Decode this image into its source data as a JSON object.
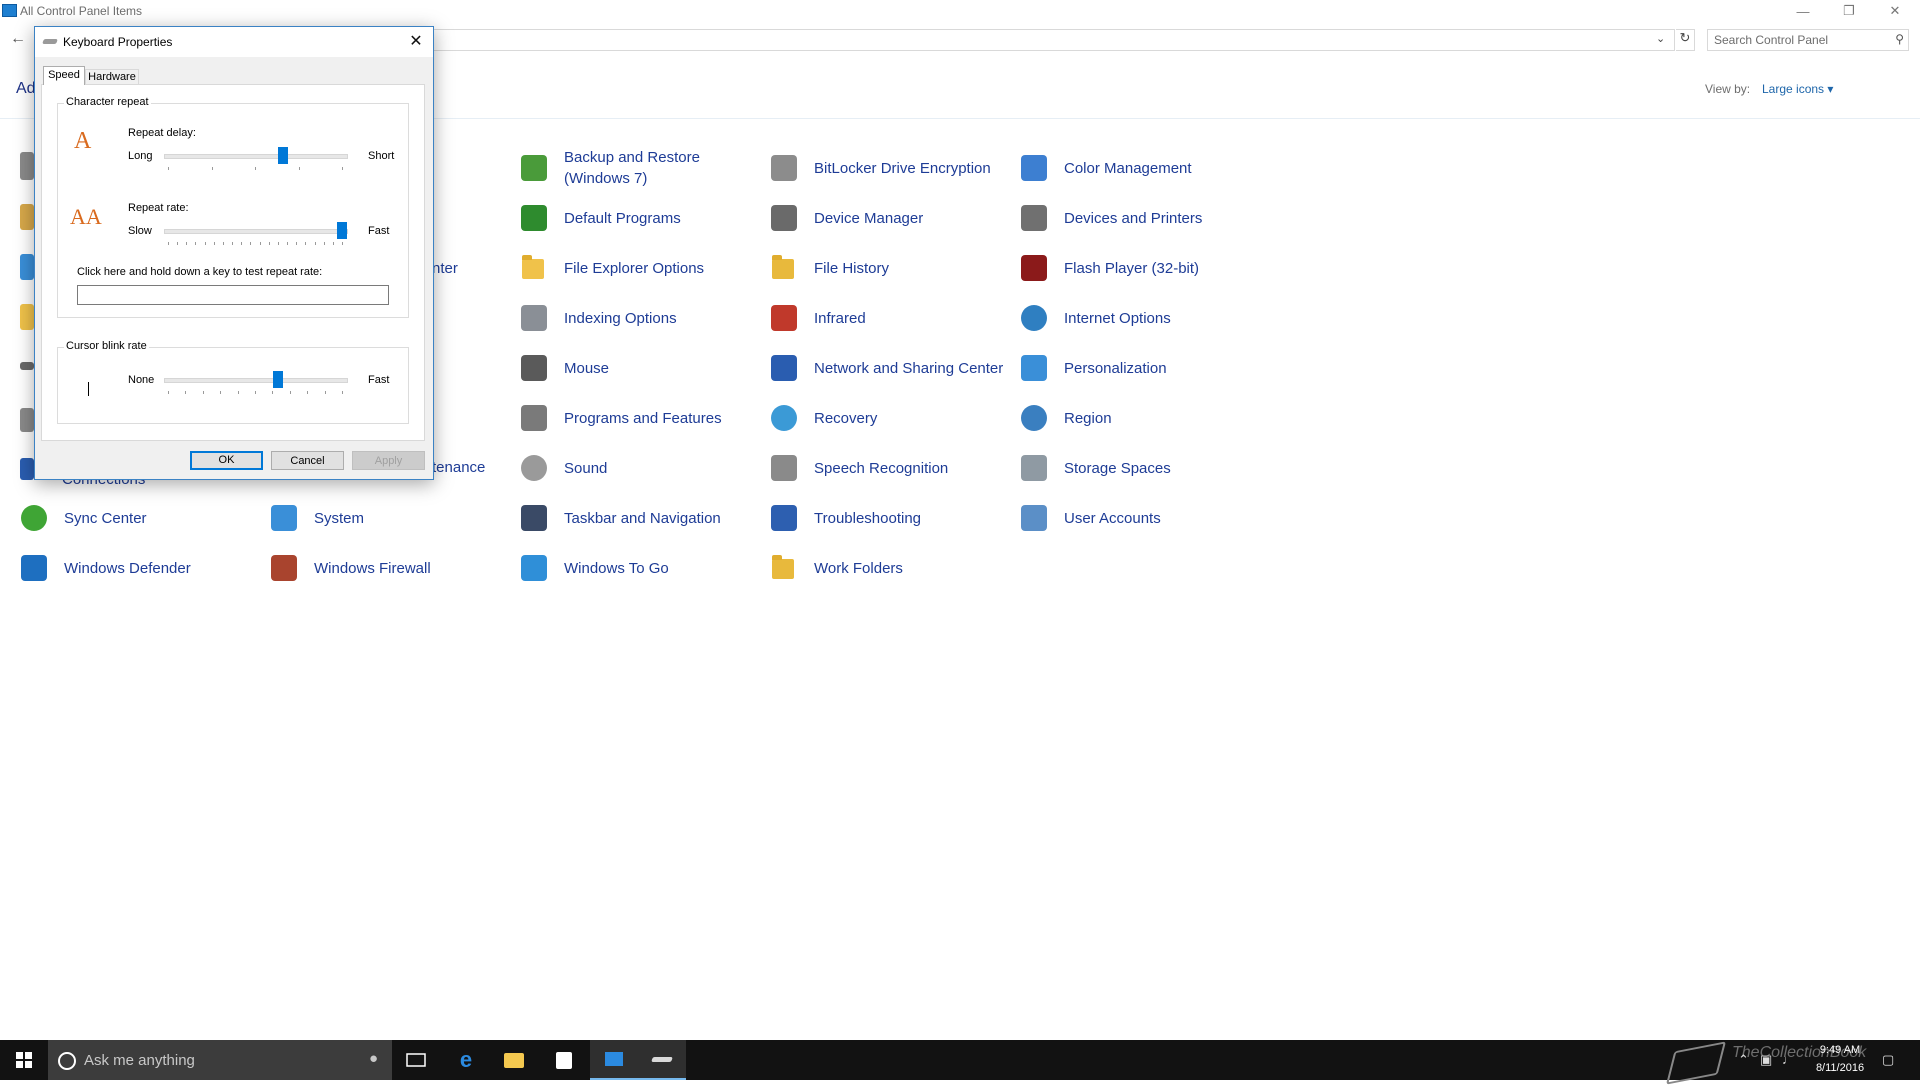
{
  "window": {
    "title": "All Control Panel Items"
  },
  "address": {
    "search_placeholder": "Search Control Panel"
  },
  "header": {
    "heading": "Ad",
    "view_by_label": "View by:",
    "view_by_value": "Large icons"
  },
  "items": [
    {
      "label": "Backup and Restore (Windows 7)",
      "icon": "backup-restore-icon",
      "color": "#4a9b3a"
    },
    {
      "label": "BitLocker Drive Encryption",
      "icon": "bitlocker-icon",
      "color": "#8c8c8c"
    },
    {
      "label": "Color Management",
      "icon": "color-management-icon",
      "color": "#3d7fd1"
    },
    {
      "label": "Default Programs",
      "icon": "default-programs-icon",
      "color": "#2e8b2e"
    },
    {
      "label": "Device Manager",
      "icon": "device-manager-icon",
      "color": "#6a6a6a"
    },
    {
      "label": "Devices and Printers",
      "icon": "devices-printers-icon",
      "color": "#707070"
    },
    {
      "label": "File Explorer Options",
      "icon": "file-explorer-options-icon",
      "color": "#f0c24a"
    },
    {
      "label": "File History",
      "icon": "file-history-icon",
      "color": "#e8b93c"
    },
    {
      "label": "Flash Player (32-bit)",
      "icon": "flash-player-icon",
      "color": "#8b1a1a"
    },
    {
      "label": "Indexing Options",
      "icon": "indexing-options-icon",
      "color": "#8a8f96"
    },
    {
      "label": "Infrared",
      "icon": "infrared-icon",
      "color": "#c0392b"
    },
    {
      "label": "Internet Options",
      "icon": "internet-options-icon",
      "color": "#2f7fc1"
    },
    {
      "label": "Mouse",
      "icon": "mouse-icon",
      "color": "#5a5a5a"
    },
    {
      "label": "Network and Sharing Center",
      "icon": "network-sharing-icon",
      "color": "#2a5db0"
    },
    {
      "label": "Personalization",
      "icon": "personalization-icon",
      "color": "#3a8fd8"
    },
    {
      "label": "Programs and Features",
      "icon": "programs-features-icon",
      "color": "#7a7a7a"
    },
    {
      "label": "Recovery",
      "icon": "recovery-icon",
      "color": "#3b9ad6"
    },
    {
      "label": "Region",
      "icon": "region-icon",
      "color": "#3a7fc0"
    },
    {
      "label": "Sound",
      "icon": "sound-icon",
      "color": "#9a9a9a"
    },
    {
      "label": "Speech Recognition",
      "icon": "speech-recognition-icon",
      "color": "#8a8a8a"
    },
    {
      "label": "Storage Spaces",
      "icon": "storage-spaces-icon",
      "color": "#8f9aa3"
    },
    {
      "label": "Sync Center",
      "icon": "sync-center-icon",
      "color": "#3fa535"
    },
    {
      "label": "System",
      "icon": "system-icon",
      "color": "#3a8fd8"
    },
    {
      "label": "Taskbar and Navigation",
      "icon": "taskbar-navigation-icon",
      "color": "#3a4a66"
    },
    {
      "label": "Troubleshooting",
      "icon": "troubleshooting-icon",
      "color": "#2d5fb0"
    },
    {
      "label": "User Accounts",
      "icon": "user-accounts-icon",
      "color": "#5b8fc7"
    },
    {
      "label": "Windows Defender",
      "icon": "windows-defender-icon",
      "color": "#1e6fc0"
    },
    {
      "label": "Windows Firewall",
      "icon": "windows-firewall-icon",
      "color": "#a9442e"
    },
    {
      "label": "Windows To Go",
      "icon": "windows-to-go-icon",
      "color": "#2f8fd8"
    },
    {
      "label": "Work Folders",
      "icon": "work-folders-icon",
      "color": "#e8b93c"
    }
  ],
  "partial_labels": {
    "center": "nter",
    "maintenance": "tenance",
    "connections": "Connections"
  },
  "dialog": {
    "title": "Keyboard Properties",
    "tabs": [
      "Speed",
      "Hardware"
    ],
    "char_repeat": {
      "group": "Character repeat",
      "delay_label": "Repeat delay:",
      "delay_min": "Long",
      "delay_max": "Short",
      "delay_level": 0.66,
      "rate_label": "Repeat rate:",
      "rate_min": "Slow",
      "rate_max": "Fast",
      "rate_level": 1.0,
      "test_label": "Click here and hold down a key to test repeat rate:"
    },
    "cursor": {
      "group": "Cursor blink rate",
      "min": "None",
      "max": "Fast",
      "level": 0.63
    },
    "buttons": {
      "ok": "OK",
      "cancel": "Cancel",
      "apply": "Apply"
    }
  },
  "taskbar": {
    "search_text": "Ask me anything",
    "tray_watermark": "TheCollectionBook",
    "time": "9:49 AM",
    "date": "8/11/2016"
  },
  "colors": {
    "link": "#1e3c96",
    "accent": "#0078d7",
    "taskbar": "#121212"
  }
}
